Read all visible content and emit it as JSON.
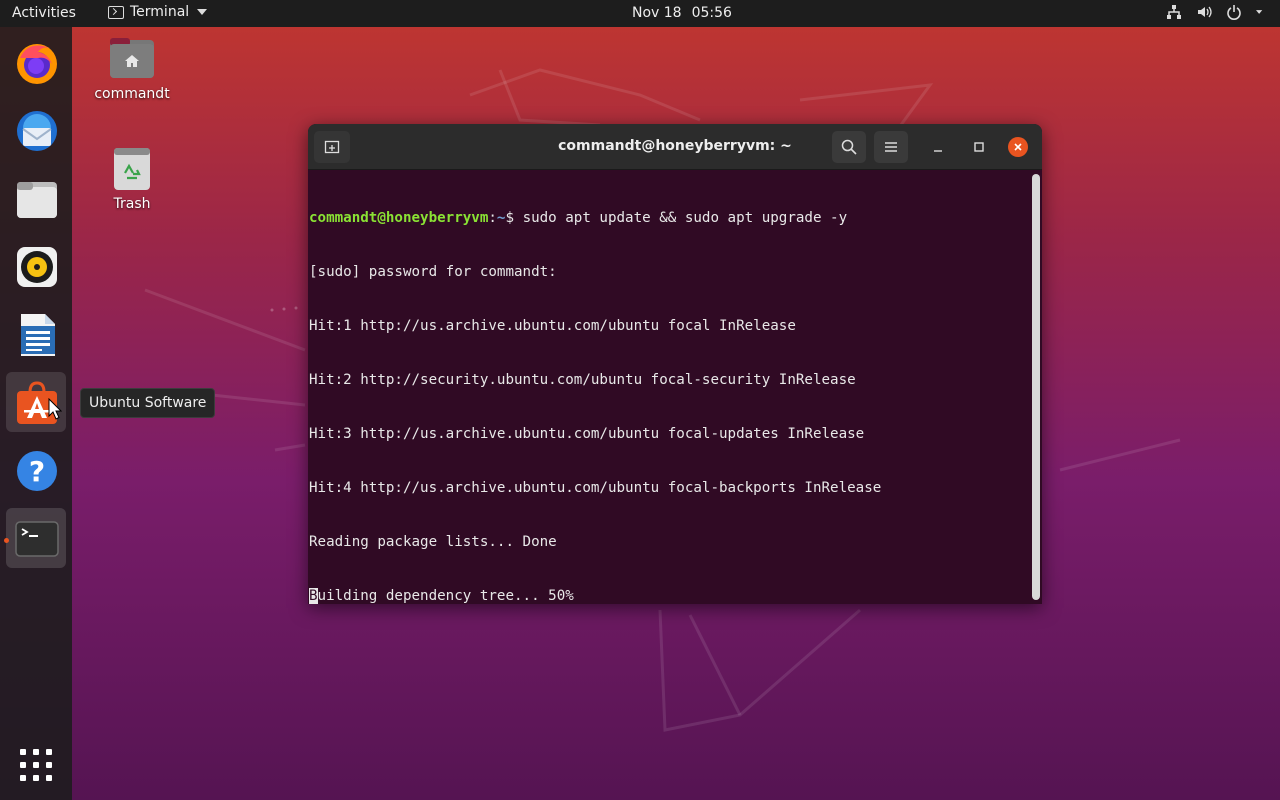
{
  "topbar": {
    "activities": "Activities",
    "app_menu": "Terminal",
    "date": "Nov 18",
    "time": "05:56",
    "tray_icons": [
      "network-icon",
      "volume-icon",
      "power-icon",
      "chevron-down-icon"
    ]
  },
  "dock": {
    "items": [
      {
        "name": "firefox",
        "icon": "firefox-icon"
      },
      {
        "name": "thunderbird",
        "icon": "thunderbird-icon"
      },
      {
        "name": "files",
        "icon": "files-icon"
      },
      {
        "name": "rhythmbox",
        "icon": "rhythmbox-icon"
      },
      {
        "name": "libreoffice-writer",
        "icon": "writer-icon"
      },
      {
        "name": "ubuntu-software",
        "icon": "ubuntu-software-icon"
      },
      {
        "name": "help",
        "icon": "help-icon"
      },
      {
        "name": "terminal",
        "icon": "terminal-icon"
      }
    ],
    "show_apps_icon": "apps-grid-icon",
    "tooltip": "Ubuntu Software"
  },
  "desktop": {
    "home_label": "commandt",
    "trash_label": "Trash"
  },
  "terminal": {
    "title": "commandt@honeyberryvm: ~",
    "prompt_user": "commandt@honeyberryvm",
    "prompt_sep": ":",
    "prompt_path": "~",
    "prompt_symbol": "$ ",
    "command": "sudo apt update && sudo apt upgrade -y",
    "output": [
      "[sudo] password for commandt:",
      "Hit:1 http://us.archive.ubuntu.com/ubuntu focal InRelease",
      "Hit:2 http://security.ubuntu.com/ubuntu focal-security InRelease",
      "Hit:3 http://us.archive.ubuntu.com/ubuntu focal-updates InRelease",
      "Hit:4 http://us.archive.ubuntu.com/ubuntu focal-backports InRelease",
      "Reading package lists... Done"
    ],
    "last_line_cursor_char": "B",
    "last_line_rest": "uilding dependency tree... 50%",
    "colors": {
      "background": "#300a24",
      "prompt_user": "#8ae234",
      "prompt_path": "#729fcf",
      "close_button": "#e95420"
    }
  }
}
